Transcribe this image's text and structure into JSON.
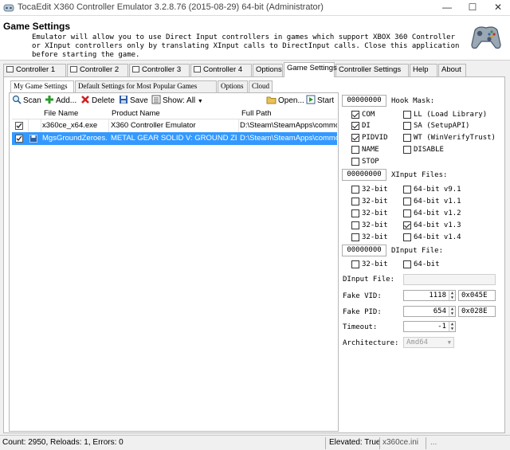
{
  "window": {
    "title": "TocaEdit X360 Controller Emulator 3.2.8.76 (2015-08-29) 64-bit (Administrator)",
    "minimize": "—",
    "maximize": "☐",
    "close": "✕"
  },
  "header": {
    "title": "Game Settings",
    "description": "Emulator will allow you to use Direct Input controllers in games which support XBOX 360 Controller or XInput controllers only by translating XInput calls to DirectInput calls. Close this application before starting the game."
  },
  "tabs": [
    {
      "label": "Controller 1"
    },
    {
      "label": "Controller 2"
    },
    {
      "label": "Controller 3"
    },
    {
      "label": "Controller 4"
    },
    {
      "label": "Options"
    },
    {
      "label": "Game Settings"
    },
    {
      "label": "Controller Settings"
    },
    {
      "label": "Help"
    },
    {
      "label": "About"
    }
  ],
  "subtabs": [
    {
      "label": "My Game Settings"
    },
    {
      "label": "Default Settings for Most Popular Games"
    },
    {
      "label": "Options"
    },
    {
      "label": "Cloud"
    }
  ],
  "toolbar": {
    "scan": "Scan",
    "add": "Add...",
    "delete": "Delete",
    "save": "Save",
    "show": "Show: All",
    "open": "Open...",
    "start": "Start"
  },
  "grid": {
    "columns": [
      "File Name",
      "Product Name",
      "Full Path"
    ],
    "rows": [
      {
        "file": "x360ce_x64.exe",
        "product": "X360 Controller Emulator",
        "path": "D:\\Steam\\SteamApps\\common\\Me"
      },
      {
        "file": "MgsGroundZeroes.exe",
        "product": "METAL GEAR SOLID V: GROUND ZEROES",
        "path": "D:\\Steam\\SteamApps\\common\\Me"
      }
    ]
  },
  "hook": {
    "button": "00000000",
    "title": "Hook Mask:",
    "options": [
      {
        "label": "COM",
        "checked": true
      },
      {
        "label": "LL (Load Library)",
        "checked": false
      },
      {
        "label": "DI",
        "checked": true
      },
      {
        "label": "SA (SetupAPI)",
        "checked": false
      },
      {
        "label": "PIDVID",
        "checked": true
      },
      {
        "label": "WT (WinVerifyTrust)",
        "checked": false
      },
      {
        "label": "NAME",
        "checked": false
      },
      {
        "label": "DISABLE",
        "checked": false
      },
      {
        "label": "STOP",
        "checked": false
      }
    ]
  },
  "xinput": {
    "button": "00000000",
    "title": "XInput Files:",
    "options": [
      {
        "label": "32-bit",
        "checked": false
      },
      {
        "label": "64-bit v9.1",
        "checked": false
      },
      {
        "label": "32-bit",
        "checked": false
      },
      {
        "label": "64-bit v1.1",
        "checked": false
      },
      {
        "label": "32-bit",
        "checked": false
      },
      {
        "label": "64-bit v1.2",
        "checked": false
      },
      {
        "label": "32-bit",
        "checked": false
      },
      {
        "label": "64-bit v1.3",
        "checked": true
      },
      {
        "label": "32-bit",
        "checked": false
      },
      {
        "label": "64-bit v1.4",
        "checked": false
      }
    ]
  },
  "dinput": {
    "button": "00000000",
    "title": "DInput File:",
    "options": [
      {
        "label": "32-bit",
        "checked": false
      },
      {
        "label": "64-bit",
        "checked": false
      }
    ],
    "file_label": "DInput File:",
    "file_value": ""
  },
  "fields": {
    "fake_vid_label": "Fake VID:",
    "fake_vid_value": "1118",
    "fake_vid_hex": "0x045E",
    "fake_pid_label": "Fake PID:",
    "fake_pid_value": "654",
    "fake_pid_hex": "0x028E",
    "timeout_label": "Timeout:",
    "timeout_value": "-1",
    "arch_label": "Architecture:",
    "arch_value": "Amd64"
  },
  "status": {
    "counts": "Count: 2950, Reloads: 1, Errors: 0",
    "elevated": "Elevated: True",
    "dll": "x360ce.ini",
    "extra": "..."
  },
  "colors": {
    "selection": "#3399ff",
    "tab_border": "#b8b8b8"
  }
}
